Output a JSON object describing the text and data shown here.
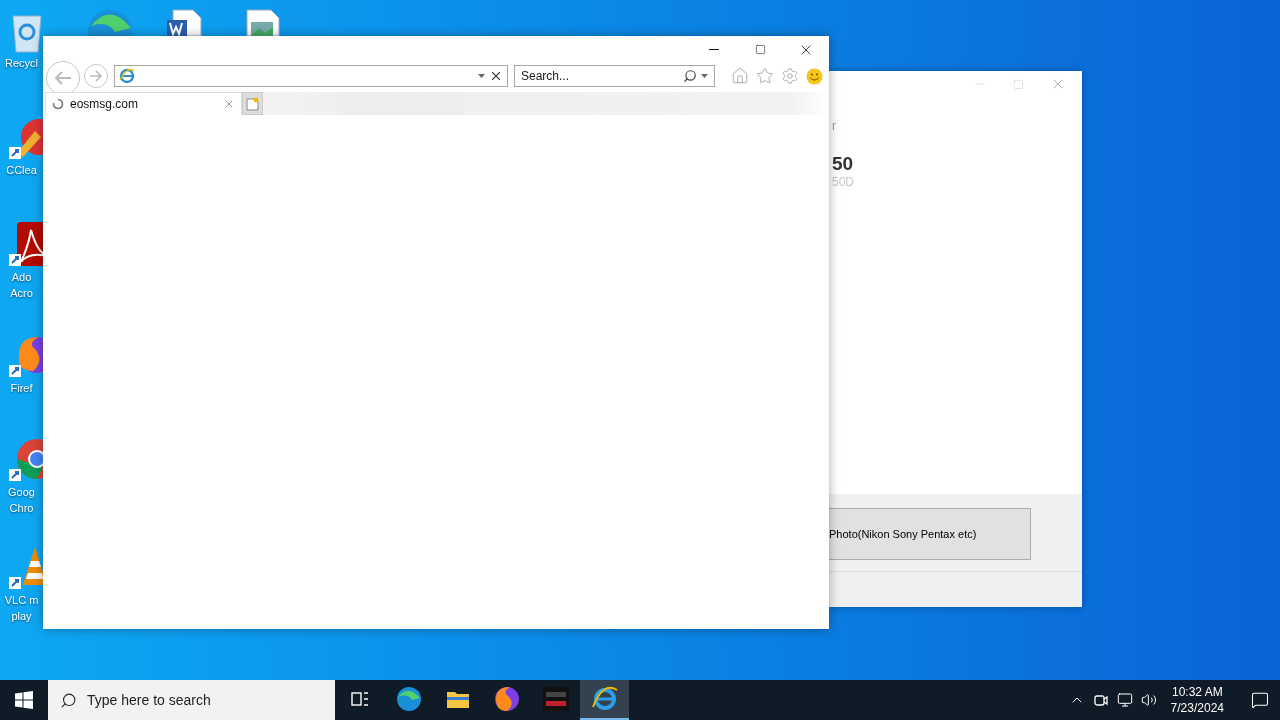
{
  "desktop_icons_top": [
    {
      "kind": "edge"
    },
    {
      "kind": "word"
    },
    {
      "kind": "image-file"
    }
  ],
  "desktop_icons_left": [
    {
      "kind": "recycle-bin",
      "label_lines": [
        "Recycl"
      ]
    },
    {
      "kind": "ccleaner",
      "label_lines": [
        "CClea"
      ]
    },
    {
      "kind": "acrobat",
      "label_lines": [
        "Ado",
        "Acro"
      ]
    },
    {
      "kind": "firefox",
      "label_lines": [
        "Firef"
      ]
    },
    {
      "kind": "chrome",
      "label_lines": [
        "Goog",
        "Chro"
      ]
    },
    {
      "kind": "vlc",
      "label_lines": [
        "VLC m",
        "play"
      ]
    }
  ],
  "background_window": {
    "heading_fragment": "r",
    "model": "50",
    "model_sub": "50D",
    "button": "Photo(Nikon Sony Pentax etc)"
  },
  "browser": {
    "search": {
      "placeholder": "Search..."
    },
    "tab": {
      "title": "eosmsg.com",
      "loading": true
    }
  },
  "taskbar": {
    "search_placeholder": "Type here to search",
    "apps": [
      {
        "kind": "task-view",
        "active": false
      },
      {
        "kind": "edge",
        "active": false
      },
      {
        "kind": "file-explorer",
        "active": false
      },
      {
        "kind": "firefox",
        "active": false
      },
      {
        "kind": "eos-msg",
        "active": false
      },
      {
        "kind": "internet-explorer",
        "active": true
      }
    ],
    "time": "10:32 AM",
    "date": "7/23/2024"
  }
}
